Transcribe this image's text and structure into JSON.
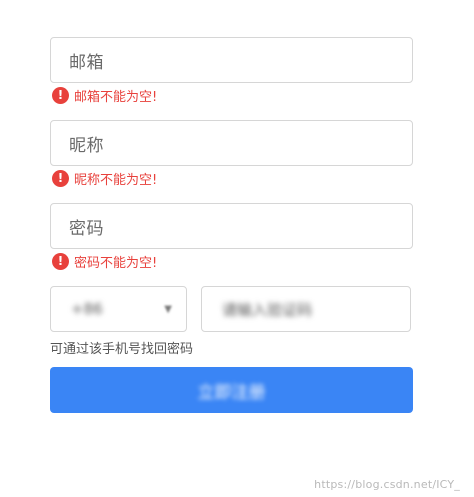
{
  "form": {
    "email": {
      "placeholder": "邮箱",
      "error": "邮箱不能为空!"
    },
    "nickname": {
      "placeholder": "昵称",
      "error": "昵称不能为空!"
    },
    "password": {
      "placeholder": "密码",
      "error": "密码不能为空!"
    },
    "phone_prefix": {
      "value": "+86",
      "caret": "▼"
    },
    "verify_code": {
      "placeholder": "请输入验证码"
    },
    "hint": "可通过该手机号找回密码",
    "submit_label": "立即注册"
  },
  "error_icon": {
    "glyph": "!",
    "color": "#e8413c"
  },
  "accent_color": "#3a85f5",
  "watermark": "https://blog.csdn.net/ICY_"
}
